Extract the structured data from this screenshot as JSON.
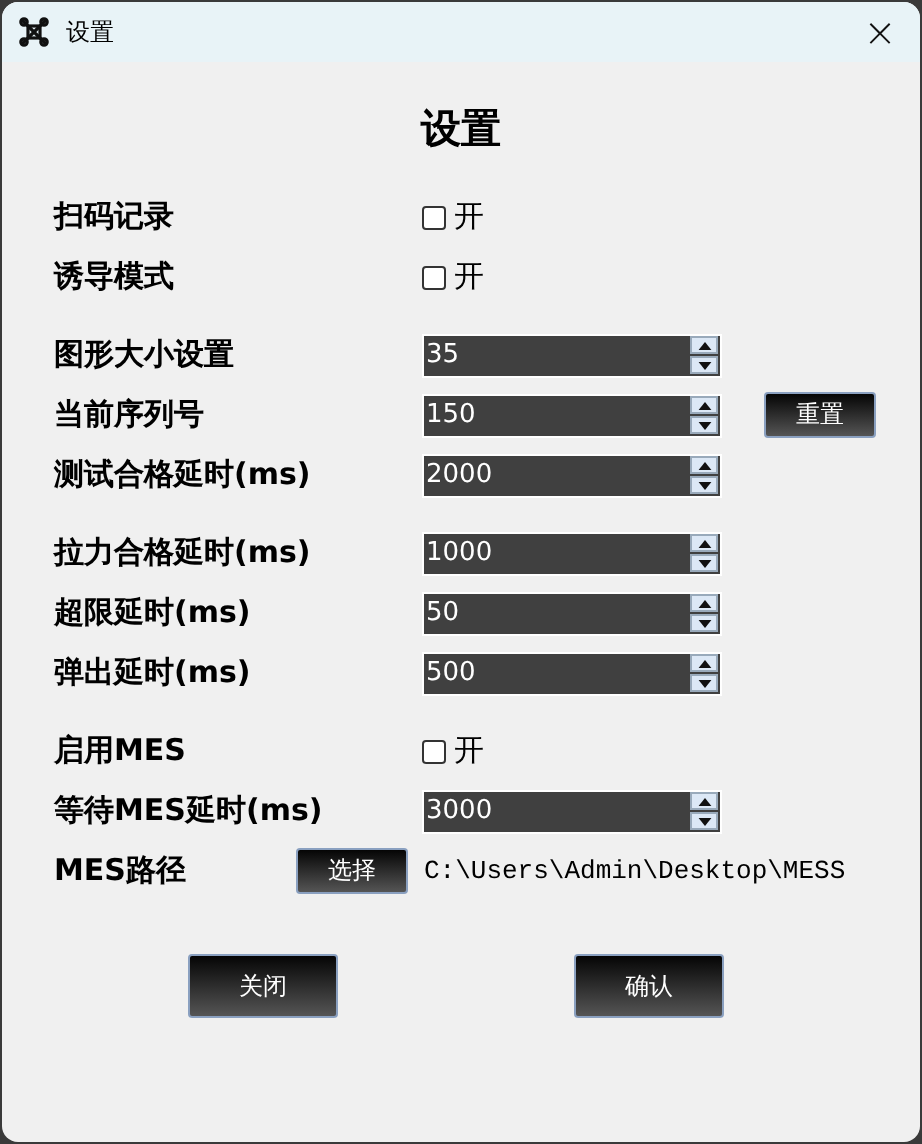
{
  "window": {
    "title": "设置",
    "close": "×"
  },
  "heading": "设置",
  "groups": [
    [
      {
        "kind": "checkbox",
        "label": "扫码记录",
        "checked": false,
        "option": "开"
      },
      {
        "kind": "checkbox",
        "label": "诱导模式",
        "checked": false,
        "option": "开"
      }
    ],
    [
      {
        "kind": "spin",
        "label": "图形大小设置",
        "value": "35"
      },
      {
        "kind": "spin",
        "label": "当前序列号",
        "value": "150",
        "button": "重置"
      },
      {
        "kind": "spin",
        "label": "测试合格延时(ms)",
        "value": "2000"
      }
    ],
    [
      {
        "kind": "spin",
        "label": "拉力合格延时(ms)",
        "value": "1000"
      },
      {
        "kind": "spin",
        "label": "超限延时(ms)",
        "value": "50"
      },
      {
        "kind": "spin",
        "label": "弹出延时(ms)",
        "value": "500"
      }
    ],
    [
      {
        "kind": "checkbox",
        "label": "启用MES",
        "checked": false,
        "option": "开"
      },
      {
        "kind": "spin",
        "label": "等待MES延时(ms)",
        "value": "3000"
      },
      {
        "kind": "path",
        "label": "MES路径",
        "button": "选择",
        "value": "C:\\Users\\Admin\\Desktop\\MESS"
      }
    ]
  ],
  "buttons": [
    "关闭",
    "确认"
  ]
}
